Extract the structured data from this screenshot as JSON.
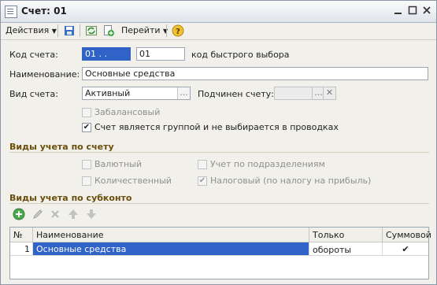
{
  "window": {
    "title": "Счет: 01"
  },
  "toolbar": {
    "actions_label": "Действия",
    "goto_label": "Перейти",
    "icons": [
      "save-icon",
      "refresh-icon",
      "new-copy-icon",
      "help-icon"
    ]
  },
  "form": {
    "account_code_label": "Код счета:",
    "account_code_value": "01 . .",
    "quick_select_code_value": "01",
    "quick_select_code_label": "код быстрого выбора",
    "name_label": "Наименование:",
    "name_value": "Основные средства",
    "account_type_label": "Вид счета:",
    "account_type_value": "Активный",
    "parent_account_label": "Подчинен счету:",
    "parent_account_value": "",
    "offbalance_label": "Забалансовый",
    "offbalance_checked": false,
    "group_label": "Счет является группой и не выбирается в проводках",
    "group_checked": true
  },
  "accounting_types": {
    "title": "Виды учета по счету",
    "currency_label": "Валютный",
    "quantity_label": "Количественный",
    "subdivision_label": "Учет по подразделениям",
    "tax_label": "Налоговый (по налогу на прибыль)"
  },
  "subconto": {
    "title": "Виды учета по субконто",
    "table_headers": [
      "№",
      "Наименование",
      "Только обороты",
      "Суммовой"
    ],
    "rows": [
      {
        "num": "1",
        "name": "Основные средства",
        "turnover_only": "",
        "summary": "✔"
      }
    ]
  },
  "colors": {
    "accent": "#2f63c8",
    "section_title": "#6b4e0c"
  }
}
